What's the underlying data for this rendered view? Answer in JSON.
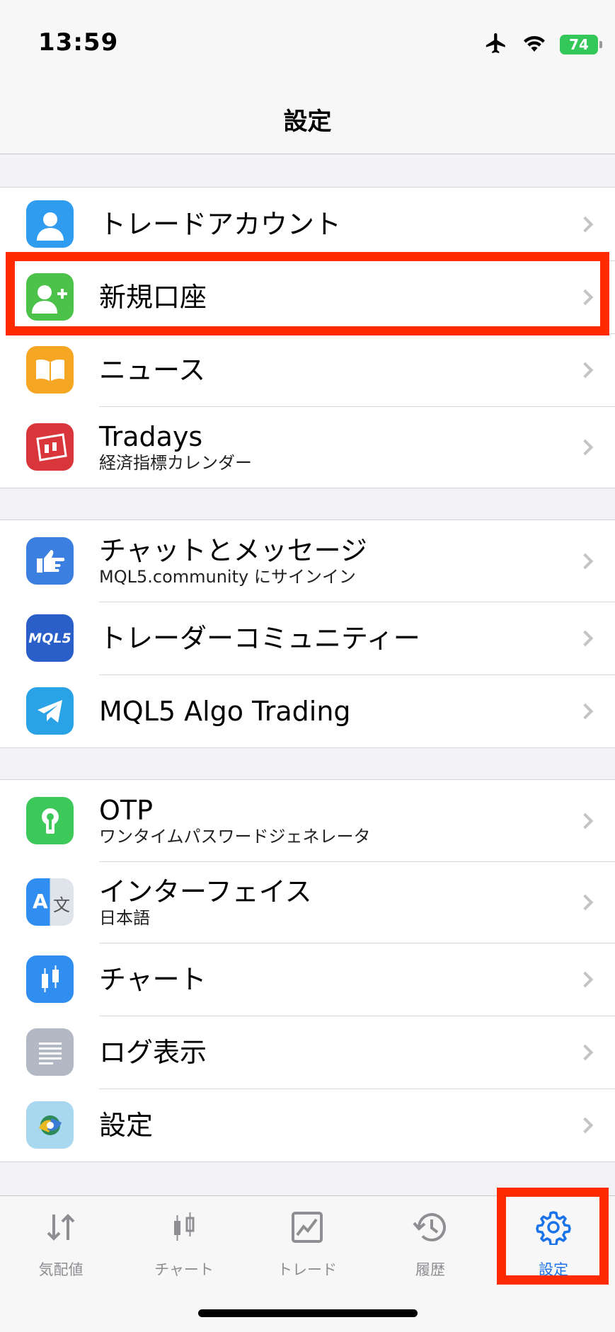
{
  "status_bar": {
    "time": "13:59",
    "battery": "74"
  },
  "header": {
    "title": "設定"
  },
  "groups": [
    {
      "items": [
        {
          "title": "トレードアカウント",
          "subtitle": "",
          "icon": "user-icon",
          "icon_color": "#2f9cf0"
        },
        {
          "title": "新規口座",
          "subtitle": "",
          "icon": "add-user-icon",
          "icon_color": "#4cc24a"
        },
        {
          "title": "ニュース",
          "subtitle": "",
          "icon": "book-icon",
          "icon_color": "#f5a623"
        },
        {
          "title": "Tradays",
          "subtitle": "経済指標カレンダー",
          "icon": "calendar-icon",
          "icon_color": "#d9363b"
        }
      ]
    },
    {
      "items": [
        {
          "title": "チャットとメッセージ",
          "subtitle": "MQL5.community にサインイン",
          "icon": "hand-point-icon",
          "icon_color": "#3b7fe0"
        },
        {
          "title": "トレーダーコミュニティー",
          "subtitle": "",
          "icon": "mql5-logo-icon",
          "icon_color": "#2a5fc9",
          "icon_text": "MQL5"
        },
        {
          "title": "MQL5 Algo Trading",
          "subtitle": "",
          "icon": "telegram-icon",
          "icon_color": "#2aa3e6"
        }
      ]
    },
    {
      "items": [
        {
          "title": "OTP",
          "subtitle": "ワンタイムパスワードジェネレータ",
          "icon": "keyhole-icon",
          "icon_color": "#3dc95a"
        },
        {
          "title": "インターフェイス",
          "subtitle": "日本語",
          "icon": "translate-icon",
          "icon_color": "#2f8ef0",
          "icon_text": "A",
          "icon_text2": "文"
        },
        {
          "title": "チャート",
          "subtitle": "",
          "icon": "candlestick-icon",
          "icon_color": "#2f8ef0"
        },
        {
          "title": "ログ表示",
          "subtitle": "",
          "icon": "log-icon",
          "icon_color": "#b3b8c5"
        },
        {
          "title": "設定",
          "subtitle": "",
          "icon": "metatrader-icon",
          "icon_color": "#a8d8f0"
        }
      ]
    }
  ],
  "tabs": [
    {
      "label": "気配値",
      "icon": "quotes-icon",
      "active": false
    },
    {
      "label": "チャート",
      "icon": "chart-icon",
      "active": false
    },
    {
      "label": "トレード",
      "icon": "trade-icon",
      "active": false
    },
    {
      "label": "履歴",
      "icon": "history-icon",
      "active": false
    },
    {
      "label": "設定",
      "icon": "gear-icon",
      "active": true
    }
  ],
  "colors": {
    "highlight": "#ff2a00",
    "tab_active": "#1a73e8",
    "tab_inactive": "#8e8e93"
  }
}
